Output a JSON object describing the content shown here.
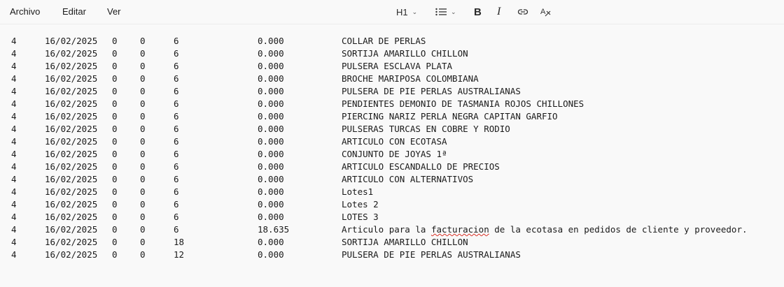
{
  "menu": {
    "file": "Archivo",
    "edit": "Editar",
    "view": "Ver"
  },
  "toolbar": {
    "heading": "H1",
    "list_icon": "list-icon",
    "bold": "B",
    "italic": "I",
    "link_icon": "link-icon",
    "clear_format_icon": "clear-format-icon"
  },
  "rows": [
    {
      "a": "4",
      "date": "16/02/2025",
      "b": "0",
      "c": "0",
      "d": "6",
      "amount": "0.000",
      "desc": "COLLAR DE PERLAS"
    },
    {
      "a": "4",
      "date": "16/02/2025",
      "b": "0",
      "c": "0",
      "d": "6",
      "amount": "0.000",
      "desc": "SORTIJA AMARILLO CHILLON"
    },
    {
      "a": "4",
      "date": "16/02/2025",
      "b": "0",
      "c": "0",
      "d": "6",
      "amount": "0.000",
      "desc": "PULSERA ESCLAVA PLATA"
    },
    {
      "a": "4",
      "date": "16/02/2025",
      "b": "0",
      "c": "0",
      "d": "6",
      "amount": "0.000",
      "desc": "BROCHE MARIPOSA COLOMBIANA"
    },
    {
      "a": "4",
      "date": "16/02/2025",
      "b": "0",
      "c": "0",
      "d": "6",
      "amount": "0.000",
      "desc": "PULSERA DE PIE PERLAS AUSTRALIANAS"
    },
    {
      "a": "4",
      "date": "16/02/2025",
      "b": "0",
      "c": "0",
      "d": "6",
      "amount": "0.000",
      "desc": "PENDIENTES DEMONIO DE TASMANIA ROJOS CHILLONES"
    },
    {
      "a": "4",
      "date": "16/02/2025",
      "b": "0",
      "c": "0",
      "d": "6",
      "amount": "0.000",
      "desc": "PIERCING NARIZ PERLA NEGRA CAPITAN GARFIO"
    },
    {
      "a": "4",
      "date": "16/02/2025",
      "b": "0",
      "c": "0",
      "d": "6",
      "amount": "0.000",
      "desc": "PULSERAS TURCAS EN COBRE Y RODIO"
    },
    {
      "a": "4",
      "date": "16/02/2025",
      "b": "0",
      "c": "0",
      "d": "6",
      "amount": "0.000",
      "desc": "ARTICULO CON ECOTASA"
    },
    {
      "a": "4",
      "date": "16/02/2025",
      "b": "0",
      "c": "0",
      "d": "6",
      "amount": "0.000",
      "desc": "CONJUNTO DE JOYAS 1ª"
    },
    {
      "a": "4",
      "date": "16/02/2025",
      "b": "0",
      "c": "0",
      "d": "6",
      "amount": "0.000",
      "desc": "ARTICULO ESCANDALLO DE PRECIOS"
    },
    {
      "a": "4",
      "date": "16/02/2025",
      "b": "0",
      "c": "0",
      "d": "6",
      "amount": "0.000",
      "desc": "ARTICULO CON ALTERNATIVOS"
    },
    {
      "a": "4",
      "date": "16/02/2025",
      "b": "0",
      "c": "0",
      "d": "6",
      "amount": "0.000",
      "desc": "Lotes1"
    },
    {
      "a": "4",
      "date": "16/02/2025",
      "b": "0",
      "c": "0",
      "d": "6",
      "amount": "0.000",
      "desc": "Lotes 2"
    },
    {
      "a": "4",
      "date": "16/02/2025",
      "b": "0",
      "c": "0",
      "d": "6",
      "amount": "0.000",
      "desc": "LOTES 3"
    },
    {
      "a": "4",
      "date": "16/02/2025",
      "b": "0",
      "c": "0",
      "d": "6",
      "amount": "18.635",
      "desc_pre": "Articulo para la ",
      "desc_flag": "facturacion",
      "desc_post": " de la ecotasa en pedidos de cliente y proveedor."
    },
    {
      "a": "4",
      "date": "16/02/2025",
      "b": "0",
      "c": "0",
      "d": "18",
      "amount": "0.000",
      "desc": "SORTIJA AMARILLO CHILLON"
    },
    {
      "a": "4",
      "date": "16/02/2025",
      "b": "0",
      "c": "0",
      "d": "12",
      "amount": "0.000",
      "desc": "PULSERA DE PIE PERLAS AUSTRALIANAS"
    }
  ]
}
